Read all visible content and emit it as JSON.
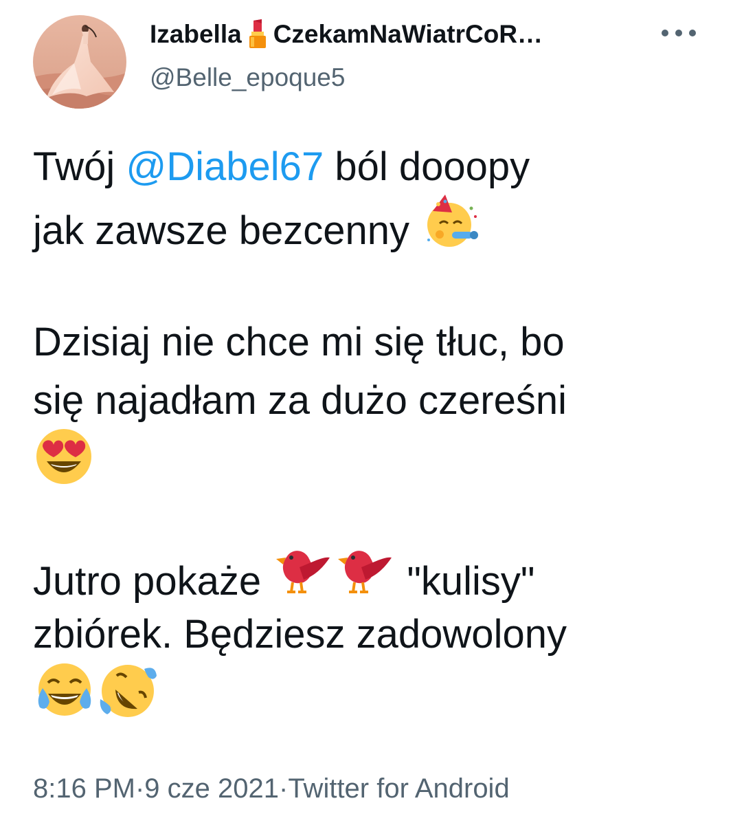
{
  "author": {
    "name_part1": "Izabella",
    "name_part2": "CzekamNaWiatrCoR…",
    "name_icon": "lipstick-icon",
    "handle": "@Belle_epoque5",
    "avatar_icon": "avatar-woman-in-desert"
  },
  "more_icon": "more-horizontal-icon",
  "tweet": {
    "line1_pre": "Twój ",
    "mention": "@Diabel67",
    "line1_post": " ból dooopy",
    "line2": "jak zawsze bezcenny",
    "line2_emoji": "partying-face-emoji",
    "line3": "Dzisiaj nie chce mi się tłuc, bo",
    "line4": "się najadłam za dużo czereśni",
    "line5_emoji": "smiling-face-with-heart-eyes-emoji",
    "line6_pre": "Jutro pokaże ",
    "line6_emojis": [
      "red-bird-emoji",
      "red-bird-emoji"
    ],
    "line6_post": " \"kulisy\"",
    "line7": "zbiórek. Będziesz zadowolony",
    "line8_emojis": [
      "face-with-tears-of-joy-emoji",
      "rolling-on-the-floor-laughing-emoji"
    ]
  },
  "footer": {
    "time": "8:16 PM",
    "sep1": " · ",
    "date": "9 cze 2021",
    "sep2": " · ",
    "source": "Twitter for Android"
  },
  "colors": {
    "text": "#0f1419",
    "secondary": "#536471",
    "link": "#1d9bf0",
    "background": "#ffffff"
  }
}
